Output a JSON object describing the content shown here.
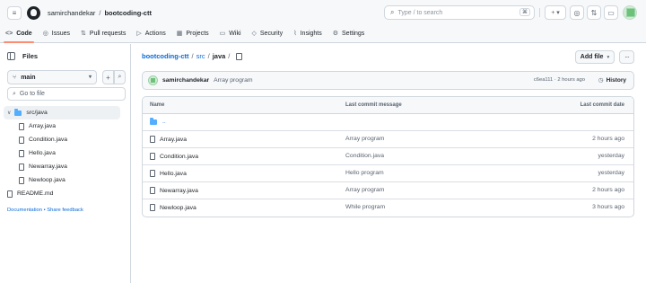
{
  "header": {
    "owner": "samirchandekar",
    "separator": "/",
    "repo": "bootcoding-ctt",
    "search_placeholder": "Type / to search",
    "search_kbd": "⌘",
    "plus_label": "+ ▾"
  },
  "tabs": [
    {
      "icon": "<>",
      "label": "Code"
    },
    {
      "icon": "◎",
      "label": "Issues"
    },
    {
      "icon": "⇅",
      "label": "Pull requests"
    },
    {
      "icon": "▷",
      "label": "Actions"
    },
    {
      "icon": "▦",
      "label": "Projects"
    },
    {
      "icon": "▭",
      "label": "Wiki"
    },
    {
      "icon": "◇",
      "label": "Security"
    },
    {
      "icon": "⌇",
      "label": "Insights"
    },
    {
      "icon": "⚙",
      "label": "Settings"
    }
  ],
  "sidebar": {
    "title": "Files",
    "branch": "main",
    "goto_placeholder": "Go to file",
    "tree": [
      {
        "type": "dir",
        "label": "src/java"
      },
      {
        "type": "file",
        "label": "Array.java"
      },
      {
        "type": "file",
        "label": "Condition.java"
      },
      {
        "type": "file",
        "label": "Hello.java"
      },
      {
        "type": "file",
        "label": "Newarray.java"
      },
      {
        "type": "file",
        "label": "Newloop.java"
      },
      {
        "type": "file",
        "root": true,
        "label": "README.md"
      }
    ],
    "docs_link": "Documentation • Share feedback"
  },
  "breadcrumb": {
    "repo": "bootcoding-ctt",
    "sep": "/",
    "p1": "src",
    "p2": "java",
    "trail": "/"
  },
  "actions": {
    "add_file": "Add file",
    "more": "···"
  },
  "commit": {
    "author": "samirchandekar",
    "message": "Array program",
    "meta": "c6ea111 · 2 hours ago",
    "history": "History"
  },
  "table": {
    "headers": {
      "name": "Name",
      "message": "Last commit message",
      "date": "Last commit date"
    },
    "parent": "..",
    "rows": [
      {
        "name": "Array.java",
        "message": "Array program",
        "date": "2 hours ago"
      },
      {
        "name": "Condition.java",
        "message": "Condition.java",
        "date": "yesterday"
      },
      {
        "name": "Hello.java",
        "message": "Hello program",
        "date": "yesterday"
      },
      {
        "name": "Newarray.java",
        "message": "Array program",
        "date": "2 hours ago"
      },
      {
        "name": "Newloop.java",
        "message": "While program",
        "date": "3 hours ago"
      }
    ]
  },
  "colors": {
    "accent": "#0969da",
    "tab_underline": "#fd8c73",
    "folder": "#54aeff",
    "border": "#d0d7de"
  }
}
